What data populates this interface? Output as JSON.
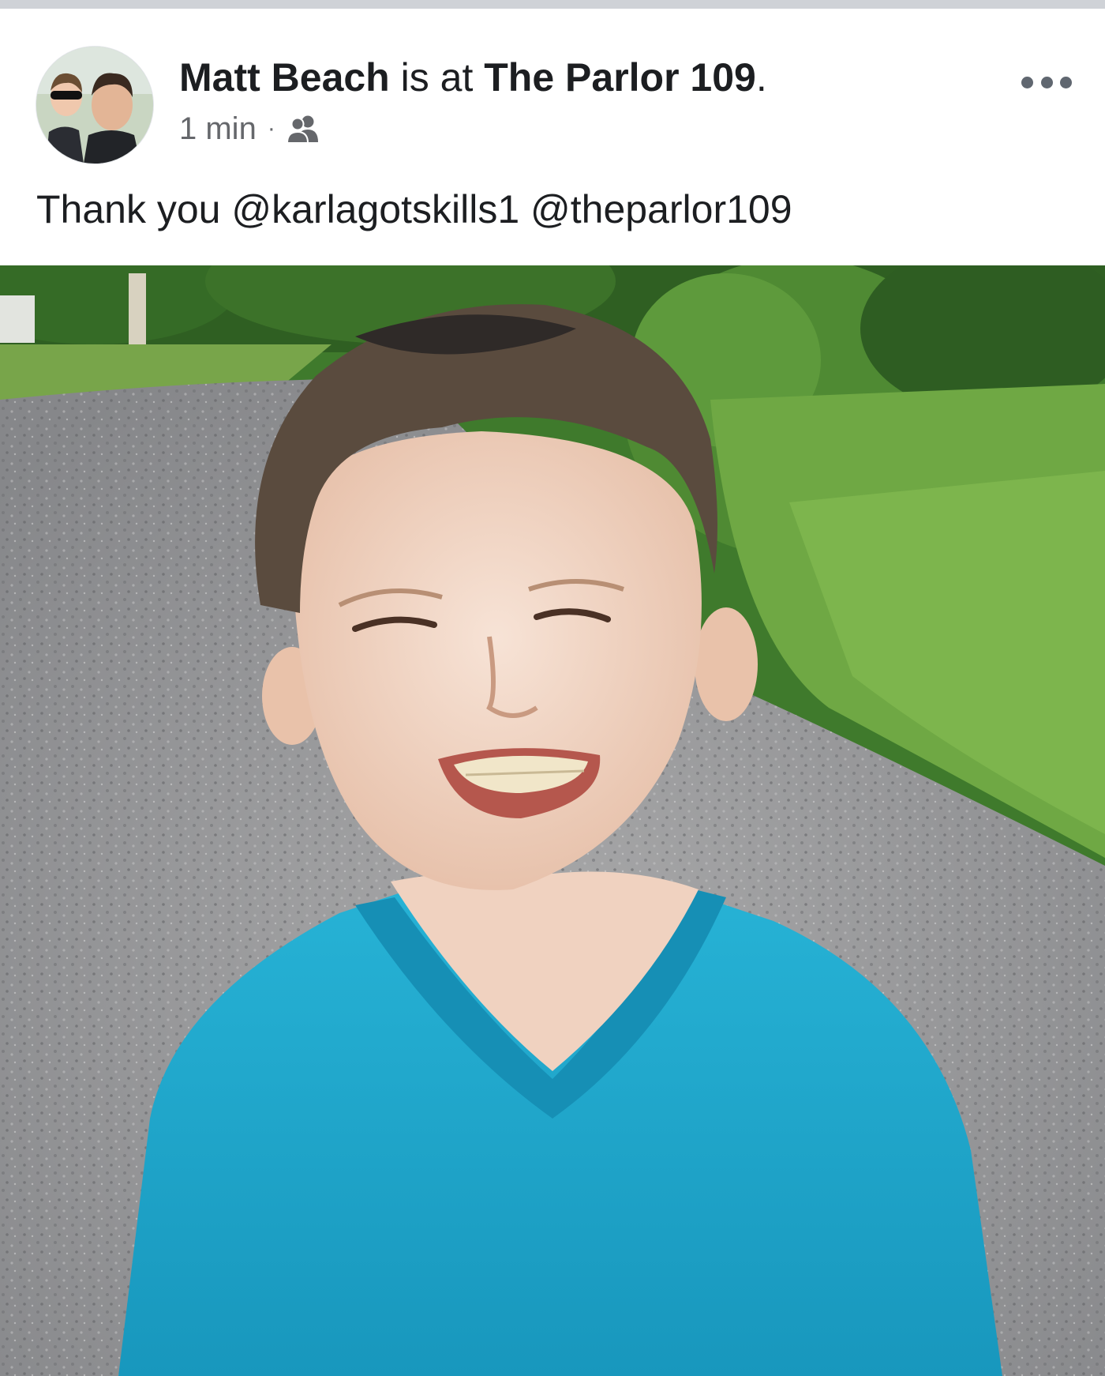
{
  "post": {
    "author": "Matt Beach",
    "action": "is at",
    "place": "The Parlor 109",
    "action_end": ".",
    "timestamp": "1 min",
    "separator": "·",
    "audience_icon": "friends-icon",
    "more_icon": "more-options-icon",
    "text": "Thank you @karlagotskills1 @theparlor109"
  },
  "colors": {
    "text_primary": "#1c1e21",
    "text_secondary": "#65676b",
    "shirt": "#1fa8cd",
    "grass": "#5d9a3a"
  }
}
